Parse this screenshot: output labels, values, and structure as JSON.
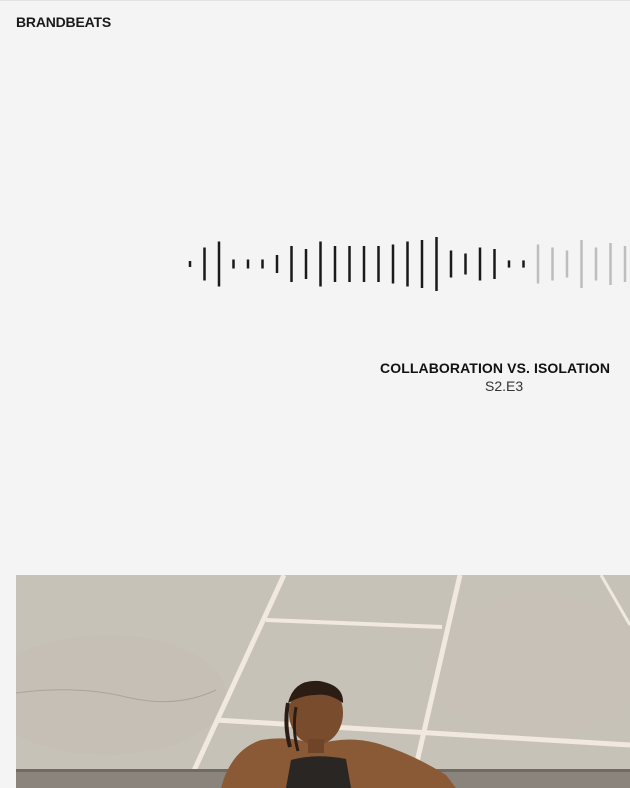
{
  "header": {
    "brand": "BRANDBEATS"
  },
  "player": {
    "episode_title": "COLLABORATION VS. ISOLATION",
    "episode_code": "S2.E3",
    "played_fraction": 0.78,
    "bar_heights": [
      0.1,
      0.55,
      0.75,
      0.15,
      0.15,
      0.15,
      0.3,
      0.6,
      0.5,
      0.75,
      0.6,
      0.6,
      0.6,
      0.6,
      0.65,
      0.75,
      0.8,
      0.9,
      0.45,
      0.35,
      0.55,
      0.5,
      0.12,
      0.12,
      0.65,
      0.55,
      0.45,
      0.8,
      0.55,
      0.7,
      0.6
    ],
    "colors": {
      "played": "#1a1a1a",
      "unplayed": "#bdbdbd"
    }
  },
  "hero_image": {
    "subject": "person-climbing-over-wall-on-sports-court"
  }
}
